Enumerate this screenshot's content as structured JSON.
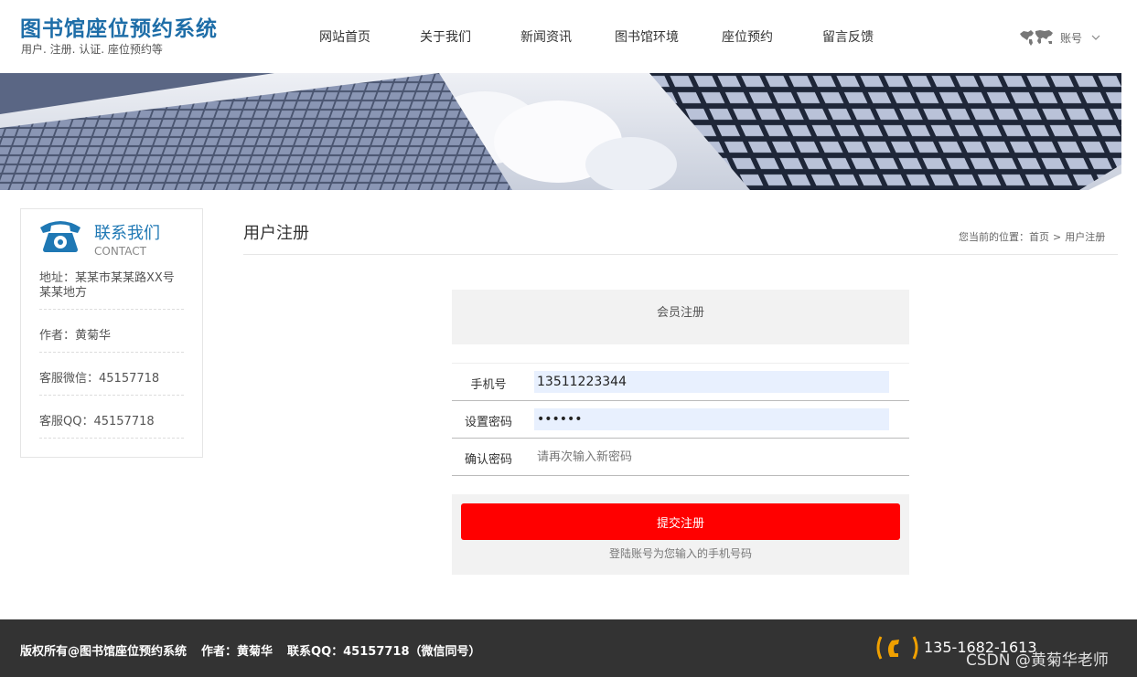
{
  "header": {
    "title": "图书馆座位预约系统",
    "subtitle": "用户. 注册. 认证. 座位预约等",
    "nav": [
      "网站首页",
      "关于我们",
      "新闻资讯",
      "图书馆环境",
      "座位预约",
      "留言反馈"
    ],
    "account_label": "账号",
    "account_icon": "world-map-icon",
    "account_chevron": "chevron-down-icon"
  },
  "sidebar": {
    "title": "联系我们",
    "title_en": "CONTACT",
    "icon": "telephone-icon",
    "address": "地址：某某市某某路XX号某某地方",
    "author": "作者：黄菊华",
    "wechat": "客服微信：45157718",
    "qq": "客服QQ：45157718"
  },
  "main": {
    "title": "用户注册",
    "breadcrumb": {
      "prefix": "您当前的位置：",
      "home": "首页",
      "separator": ">",
      "current": "用户注册"
    }
  },
  "form": {
    "heading": "会员注册",
    "phone_label": "手机号",
    "phone_value": "13511223344",
    "password_label": "设置密码",
    "password_value": "••••••",
    "confirm_label": "确认密码",
    "confirm_placeholder": "请再次输入新密码",
    "submit_label": "提交注册",
    "note": "登陆账号为您输入的手机号码"
  },
  "footer": {
    "copyright": "版权所有@图书馆座位预约系统",
    "author": "作者：黄菊华",
    "contact": "联系QQ：45157718（微信同号）",
    "phone": "135-1682-1613",
    "watermark": "CSDN @黄菊华老师"
  },
  "colors": {
    "brand": "#1f6ea8",
    "submit": "#ff0000",
    "footer_bg": "#333333",
    "phone_icon_accent": "#f0a000"
  }
}
